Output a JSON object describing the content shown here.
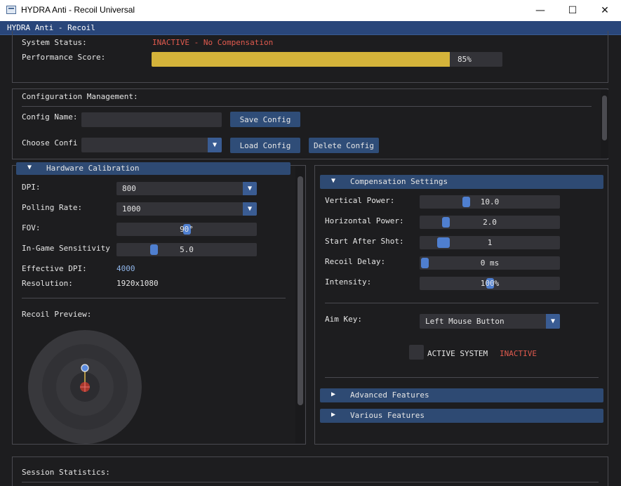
{
  "window": {
    "title": "HYDRA Anti - Recoil Universal",
    "minimize": "—",
    "maximize": "☐",
    "close": "✕"
  },
  "imgui_title": "HYDRA Anti - Recoil",
  "status": {
    "system_label": "System Status:",
    "system_value": "INACTIVE - No Compensation",
    "perf_label": "Performance Score:",
    "perf_value": "85%",
    "perf_fraction": 0.85
  },
  "config": {
    "section_title": "Configuration Management:",
    "name_label": "Config Name:",
    "name_value": "",
    "save_button": "Save Config",
    "choose_label": "Choose Confi",
    "choose_value": "",
    "load_button": "Load Config",
    "delete_button": "Delete Config"
  },
  "hardware": {
    "header": "Hardware Calibration",
    "dpi_label": "DPI:",
    "dpi_value": "800",
    "polling_label": "Polling Rate:",
    "polling_value": "1000",
    "fov_label": "FOV:",
    "fov_value": "90°",
    "fov_fraction": 0.5,
    "sens_label": "In-Game Sensitivity",
    "sens_value": "5.0",
    "sens_fraction": 0.25,
    "eff_dpi_label": "Effective DPI:",
    "eff_dpi_value": "4000",
    "resolution_label": "Resolution:",
    "resolution_value": "1920x1080",
    "preview_label": "Recoil Preview:"
  },
  "compensation": {
    "header": "Compensation Settings",
    "vertical_label": "Vertical Power:",
    "vertical_value": "10.0",
    "vertical_fraction": 0.32,
    "horizontal_label": "Horizontal Power:",
    "horizontal_value": "2.0",
    "horizontal_fraction": 0.16,
    "start_label": "Start After Shot:",
    "start_value": "1",
    "start_fraction": 0.13,
    "delay_label": "Recoil Delay:",
    "delay_value": "0 ms",
    "delay_fraction": 0.0,
    "intensity_label": "Intensity:",
    "intensity_value": "100%",
    "intensity_fraction": 0.5,
    "aimkey_label": "Aim Key:",
    "aimkey_value": "Left Mouse Button",
    "active_label": "ACTIVE SYSTEM",
    "active_status": "INACTIVE",
    "advanced_header": "Advanced Features",
    "various_header": "Various Features"
  },
  "session": {
    "title": "Session Statistics:"
  },
  "colors": {
    "accent": "#4f7fd0",
    "bar": "#d4b33a",
    "inactive": "#e05a4e",
    "header": "#2e4a73"
  },
  "icons": {
    "collapse_open": "▼",
    "collapse_closed": "▶",
    "combo_arrow": "▼"
  }
}
